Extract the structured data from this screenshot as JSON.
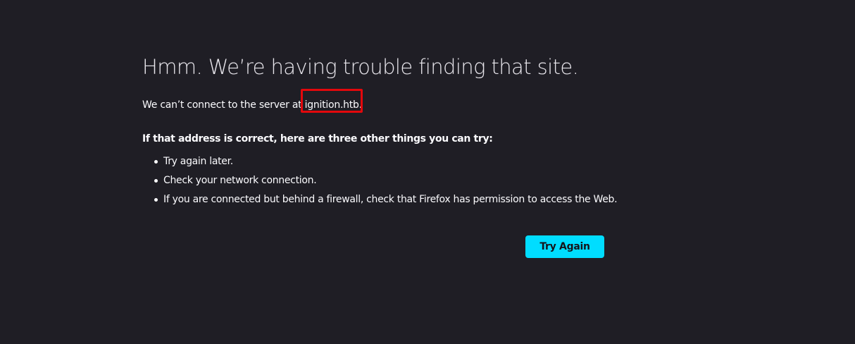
{
  "error_page": {
    "title": "Hmm. We’re having trouble finding that site.",
    "intro_prefix": "We can’t connect to the server at ",
    "host": "ignition.htb",
    "intro_suffix": ".",
    "suggestions_heading": "If that address is correct, here are three other things you can try:",
    "suggestions": [
      "Try again later.",
      "Check your network connection.",
      "If you are connected but behind a firewall, check that Firefox has permission to access the Web."
    ],
    "try_again_label": "Try Again"
  },
  "colors": {
    "background": "#1f1e25",
    "text": "#fbfbfe",
    "accent_button": "#00ddff",
    "highlight_box": "#e3080c"
  }
}
